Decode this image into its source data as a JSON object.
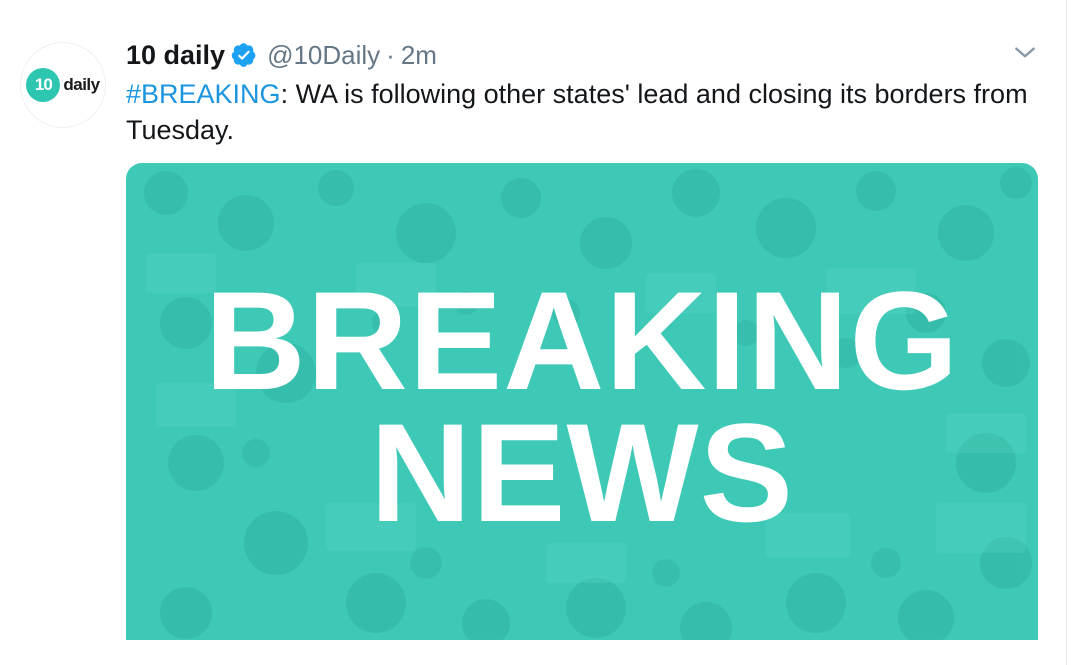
{
  "tweet": {
    "display_name": "10 daily",
    "handle": "@10Daily",
    "separator": "·",
    "time": "2m",
    "hashtag": "#BREAKING",
    "text_rest": ": WA is following other states' lead and closing its borders from Tuesday."
  },
  "avatar": {
    "mark": "10",
    "word": "daily"
  },
  "media": {
    "line1": "BREAKING",
    "line2": "NEWS"
  },
  "colors": {
    "accent": "#1b95e0",
    "media_background": "#3ec9b7",
    "brand": "#2dc6b1",
    "muted_text": "#657786"
  },
  "icons": {
    "verified": "verified-badge-icon",
    "caret": "chevron-down-icon"
  }
}
